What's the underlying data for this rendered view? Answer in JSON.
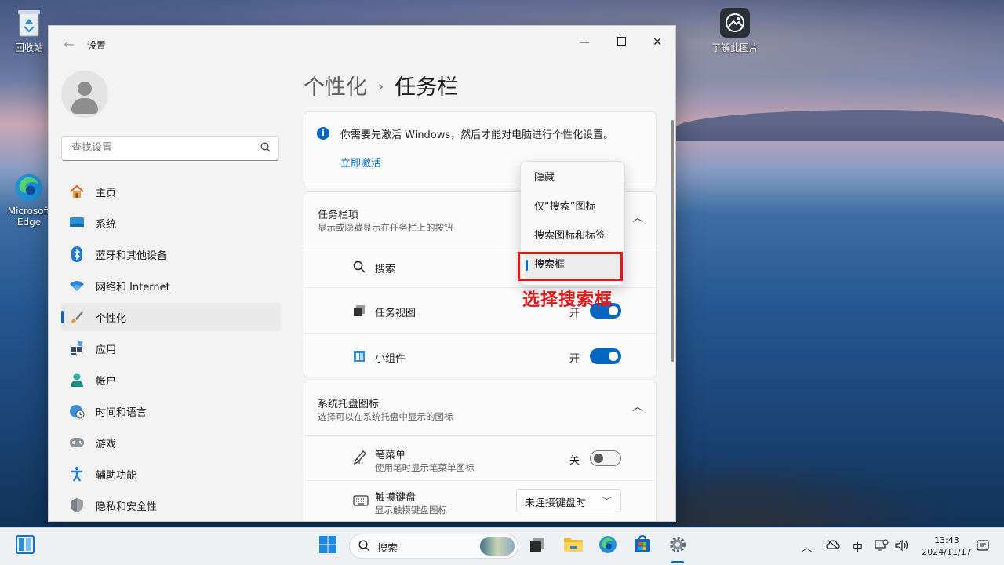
{
  "desktop": {
    "recycle_bin": "回收站",
    "edge_line1": "Microsoft",
    "edge_line2": "Edge",
    "spotlight": "了解此图片"
  },
  "window": {
    "title": "设置",
    "back_icon": "back-arrow-icon",
    "minimize_icon": "minimize-icon",
    "maximize_icon": "maximize-icon",
    "close_icon": "close-icon"
  },
  "sidebar": {
    "search_placeholder": "查找设置",
    "items": [
      {
        "label": "主页",
        "icon": "home-icon"
      },
      {
        "label": "系统",
        "icon": "display-icon"
      },
      {
        "label": "蓝牙和其他设备",
        "icon": "bluetooth-icon"
      },
      {
        "label": "网络和 Internet",
        "icon": "wifi-icon"
      },
      {
        "label": "个性化",
        "icon": "brush-icon",
        "active": true
      },
      {
        "label": "应用",
        "icon": "apps-icon"
      },
      {
        "label": "帐户",
        "icon": "account-icon"
      },
      {
        "label": "时间和语言",
        "icon": "globe-clock-icon"
      },
      {
        "label": "游戏",
        "icon": "gamepad-icon"
      },
      {
        "label": "辅助功能",
        "icon": "accessibility-icon"
      },
      {
        "label": "隐私和安全性",
        "icon": "shield-icon"
      }
    ]
  },
  "main": {
    "breadcrumb_parent": "个性化",
    "breadcrumb_current": "任务栏",
    "activation": {
      "message": "你需要先激活 Windows，然后才能对电脑进行个性化设置。",
      "link": "立即激活"
    },
    "taskbar_items": {
      "title": "任务栏项",
      "subtitle": "显示或隐藏显示在任务栏上的按钮",
      "rows": [
        {
          "label": "搜索",
          "icon": "search-icon"
        },
        {
          "label": "任务视图",
          "icon": "task-view-icon",
          "state": "开",
          "on": true
        },
        {
          "label": "小组件",
          "icon": "widgets-icon",
          "state": "开",
          "on": true
        }
      ]
    },
    "tray_icons": {
      "title": "系统托盘图标",
      "subtitle": "选择可以在系统托盘中显示的图标",
      "rows": [
        {
          "label": "笔菜单",
          "sublabel": "使用笔时显示笔菜单图标",
          "icon": "pen-icon",
          "state": "关",
          "on": false
        },
        {
          "label": "触摸键盘",
          "sublabel": "显示触摸键盘图标",
          "icon": "keyboard-icon",
          "select": "未连接键盘时"
        }
      ]
    }
  },
  "dropdown": {
    "options": [
      "隐藏",
      "仅“搜索”图标",
      "搜索图标和标签",
      "搜索框"
    ],
    "selected": "搜索框"
  },
  "annotation": {
    "text": "选择搜索框",
    "color": "#e4161b"
  },
  "taskbar": {
    "search_label": "搜索",
    "lang": "中",
    "time": "13:43",
    "date": "2024/11/17"
  },
  "colors": {
    "accent": "#0067c0",
    "annotation_red": "#e4161b"
  }
}
